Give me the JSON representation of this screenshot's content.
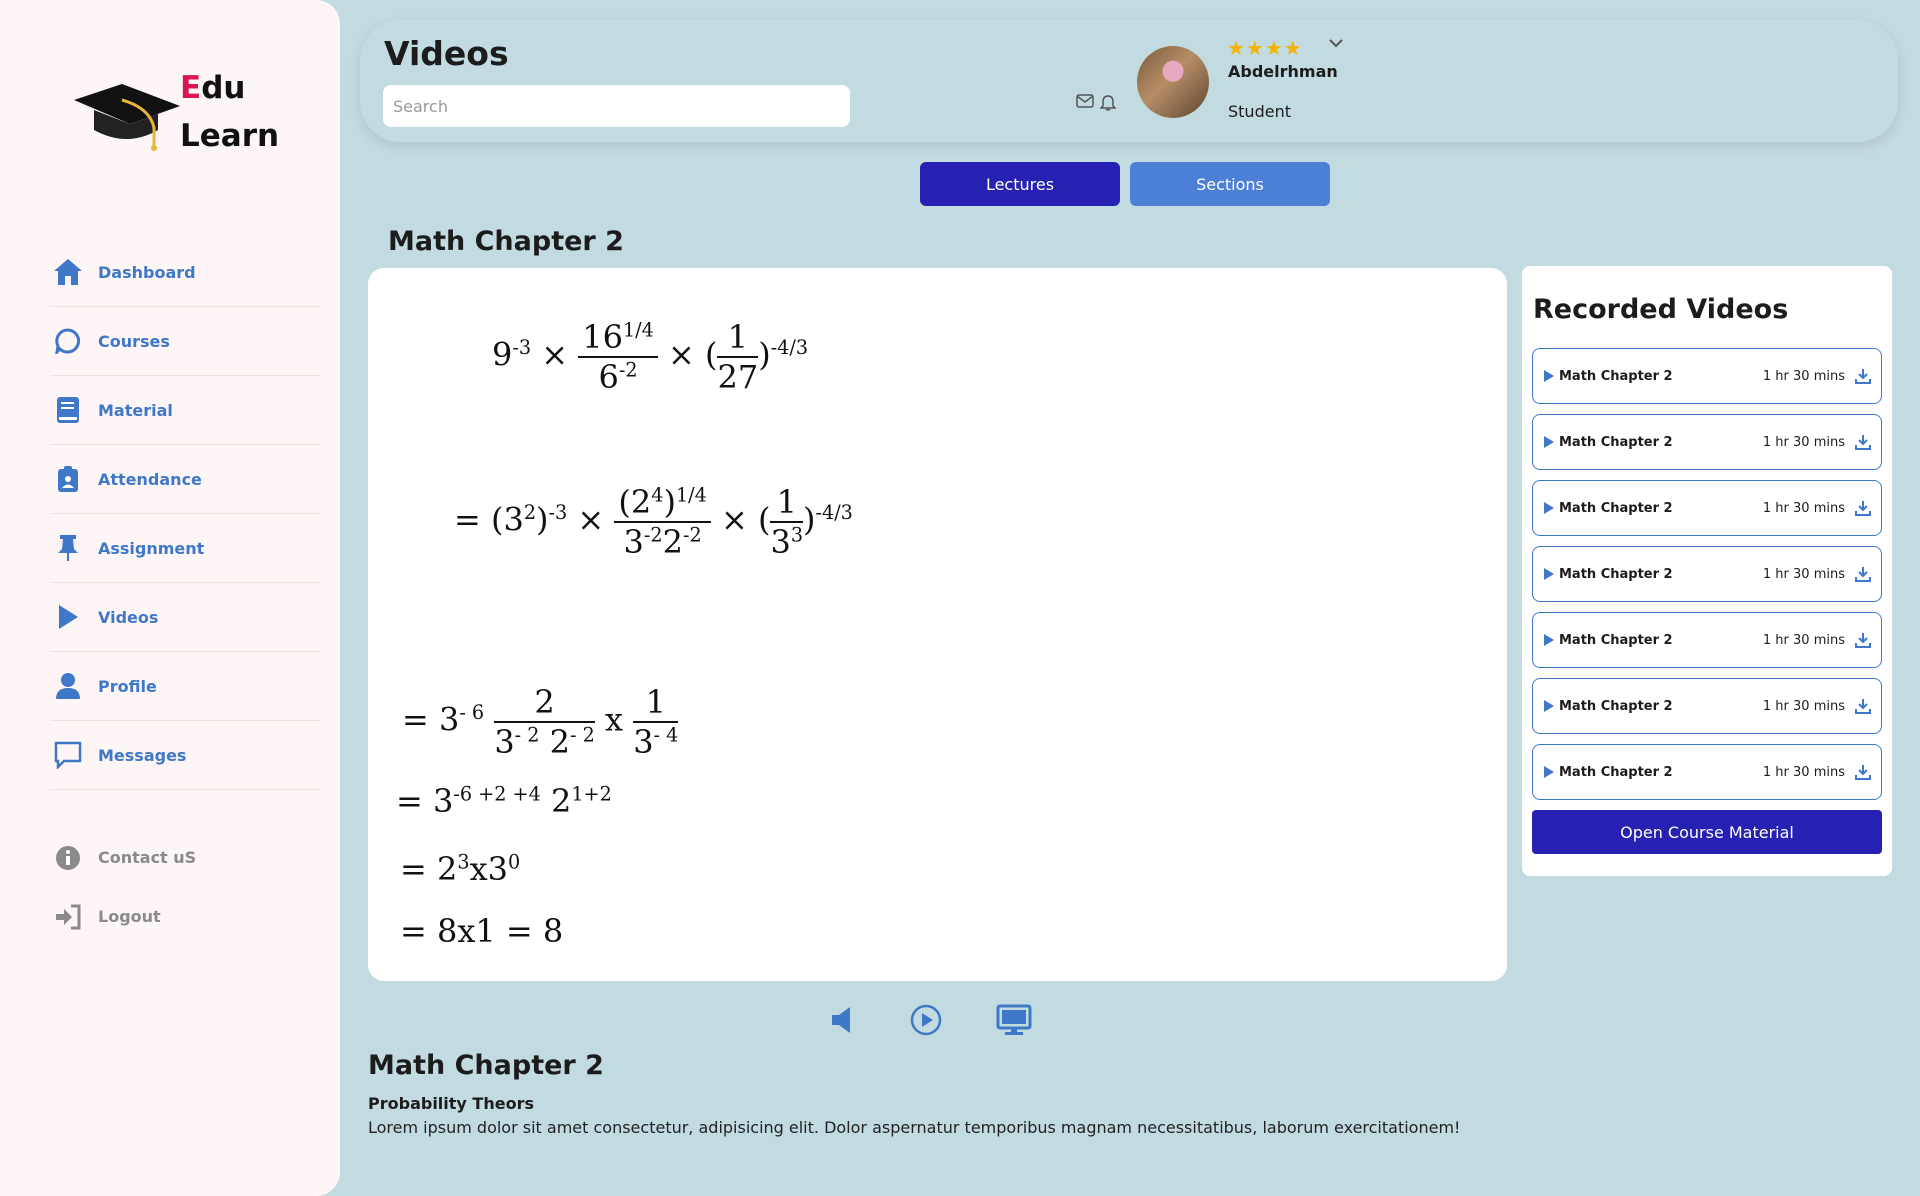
{
  "brand": {
    "letter_e": "E",
    "rest1": "du",
    "line2": "Learn"
  },
  "sidebar": {
    "items": [
      {
        "label": "Dashboard",
        "icon": "home-icon"
      },
      {
        "label": "Courses",
        "icon": "chat-bubble-icon"
      },
      {
        "label": "Material",
        "icon": "book-icon"
      },
      {
        "label": "Attendance",
        "icon": "clipboard-icon"
      },
      {
        "label": "Assignment",
        "icon": "pin-icon"
      },
      {
        "label": "Videos",
        "icon": "play-icon"
      },
      {
        "label": "Profile",
        "icon": "user-icon"
      },
      {
        "label": "Messages",
        "icon": "message-icon"
      }
    ],
    "secondary": [
      {
        "label": "Contact uS",
        "icon": "info-icon"
      },
      {
        "label": "Logout",
        "icon": "logout-icon"
      }
    ]
  },
  "header": {
    "title": "Videos",
    "search_placeholder": "Search",
    "rating_stars": "★★★★",
    "user_name": "Abdelrhman",
    "user_role": "Student"
  },
  "tabs": {
    "lectures": "Lectures",
    "sections": "Sections"
  },
  "chapter_title": "Math Chapter 2",
  "math": {
    "l1_base": "9",
    "l1_exp": "-3",
    "l1_num": "16",
    "l1_num_exp": "1/4",
    "l1_den": "6",
    "l1_den_exp": "-2",
    "l1_f2_num": "1",
    "l1_f2_den": "27",
    "l1_f2_exp": "-4/3",
    "l2_prefix": "= (3",
    "l2_exp1": "2",
    "l2_paren": ")",
    "l2_exp2": "-3",
    "l2_num": "(2",
    "l2_num_exp": "4",
    "l2_num_exp2": "1/4",
    "l2_den": "3",
    "l2_den_exp": "-2",
    "l2_den2": "2",
    "l2_den_exp2": "-2",
    "l2_f2_num": "1",
    "l2_f2_den": "3",
    "l2_f2_den_exp": "3",
    "l2_f2_exp": "-4/3",
    "l3_prefix": "= 3",
    "l3_exp": "- 6",
    "l3_num": "2",
    "l3_den": "3",
    "l3_den_exp": "- 2",
    "l3_den2": "2",
    "l3_den2_exp": "- 2",
    "l3_x": "x",
    "l3_f2_num": "1",
    "l3_f2_den": "3",
    "l3_f2_den_exp": "- 4",
    "l4_prefix": "= 3",
    "l4_exp": "-6 +2 +4",
    "l4_b2": "2",
    "l4_exp2": "1+2",
    "l5_prefix": "= 2",
    "l5_exp": "3",
    "l5_mid": "x3",
    "l5_exp2": "0",
    "l6": "= 8x1 = 8"
  },
  "description": {
    "title": "Math Chapter 2",
    "subtitle": "Probability Theors",
    "text": "Lorem ipsum dolor sit amet consectetur, adipisicing elit. Dolor aspernatur temporibus magnam necessitatibus, laborum exercitationem!"
  },
  "recorded": {
    "title": "Recorded Videos",
    "items": [
      {
        "name": "Math Chapter 2",
        "duration": "1 hr 30 mins"
      },
      {
        "name": "Math Chapter 2",
        "duration": "1 hr 30 mins"
      },
      {
        "name": "Math Chapter 2",
        "duration": "1 hr 30 mins"
      },
      {
        "name": "Math Chapter 2",
        "duration": "1 hr 30 mins"
      },
      {
        "name": "Math Chapter 2",
        "duration": "1 hr 30 mins"
      },
      {
        "name": "Math Chapter 2",
        "duration": "1 hr 30 mins"
      },
      {
        "name": "Math Chapter 2",
        "duration": "1 hr 30 mins"
      }
    ],
    "open_button": "Open Course Material"
  },
  "colors": {
    "primary": "#2621b3",
    "secondary": "#4c7fd6",
    "accent_link": "#3f78c8",
    "brand_e": "#d9164f",
    "star": "#f4b400"
  }
}
